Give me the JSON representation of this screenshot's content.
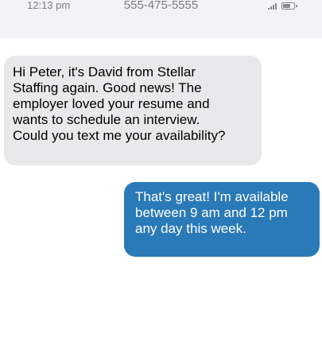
{
  "status_bar": {
    "time": "12:13 pm",
    "phone_number": "555-475-5555",
    "signal_icon": "signal-bars-icon",
    "battery_icon": "battery-icon"
  },
  "messages": [
    {
      "direction": "received",
      "text": "Hi Peter, it's David from Stellar\nStaffing again. Good news! The\nemployer loved your resume and\nwants to schedule an interview.\nCould you text me your availability?"
    },
    {
      "direction": "sent",
      "text": "That's great! I'm available\nbetween 9 am and 12 pm\nany day this week."
    }
  ],
  "colors": {
    "received_bubble": "#e9e9eb",
    "sent_bubble": "#2a7ab8",
    "status_bar_bg": "#f2f2f7"
  }
}
